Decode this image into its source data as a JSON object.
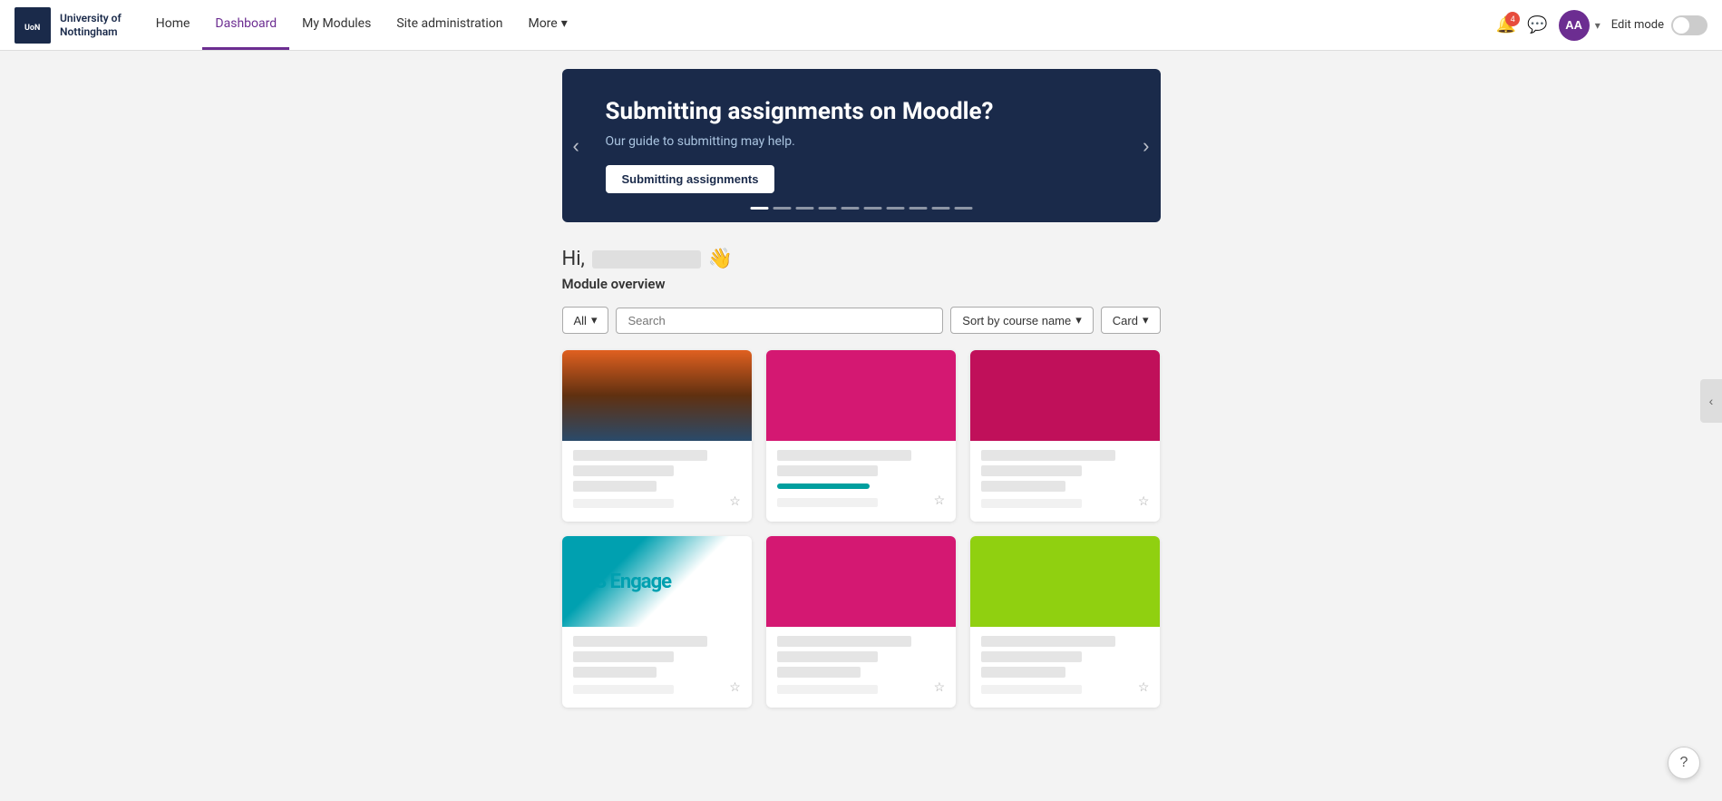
{
  "brand": {
    "logo_text": "UoN",
    "name_line1": "University of",
    "name_line2": "Nottingham"
  },
  "nav": {
    "links": [
      {
        "id": "home",
        "label": "Home",
        "active": false
      },
      {
        "id": "dashboard",
        "label": "Dashboard",
        "active": true
      },
      {
        "id": "my-modules",
        "label": "My Modules",
        "active": false
      },
      {
        "id": "site-admin",
        "label": "Site administration",
        "active": false
      },
      {
        "id": "more",
        "label": "More",
        "active": false
      }
    ],
    "edit_mode_label": "Edit mode",
    "user_initials": "AA"
  },
  "banner": {
    "title": "Submitting assignments on Moodle?",
    "subtitle": "Our guide to submitting may help.",
    "button_label": "Submitting assignments",
    "dots_count": 10
  },
  "greeting": {
    "prefix": "Hi,",
    "wave_emoji": "👋"
  },
  "module_overview": {
    "section_title": "Module overview",
    "filter_all_label": "All",
    "search_placeholder": "Search",
    "sort_label": "Sort by course name",
    "view_label": "Card"
  },
  "cards": [
    {
      "id": 1,
      "color": "city",
      "has_progress": false
    },
    {
      "id": 2,
      "color": "pink1",
      "has_progress": true
    },
    {
      "id": 3,
      "color": "pink2",
      "has_progress": false
    },
    {
      "id": 4,
      "color": "engage",
      "has_progress": false
    },
    {
      "id": 5,
      "color": "pink3",
      "has_progress": false
    },
    {
      "id": 6,
      "color": "lime",
      "has_progress": false
    }
  ],
  "help_button_label": "?",
  "sidebar_toggle_icon": "‹"
}
